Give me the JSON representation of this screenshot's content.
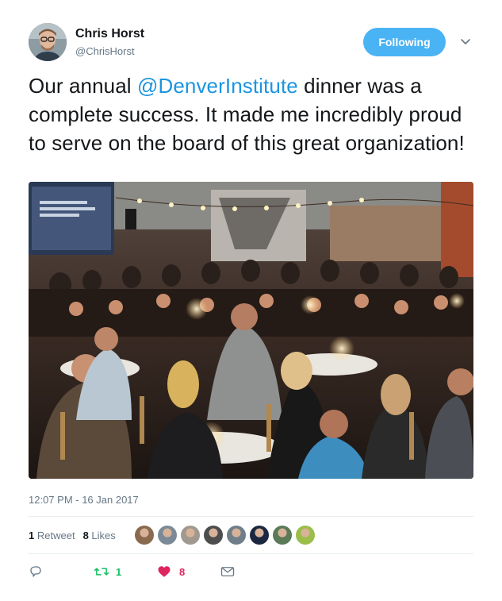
{
  "author": {
    "name": "Chris Horst",
    "handle": "@ChrisHorst",
    "avatar_icon": "person-avatar"
  },
  "follow_button": {
    "label": "Following",
    "color": "#4ab3f4"
  },
  "menu_icon": "chevron-down-icon",
  "tweet": {
    "text_before": "Our annual ",
    "mention": "@DenverInstitute",
    "text_after": " dinner was a complete success. It made me incredibly proud to serve on the board of this great organization!",
    "mention_color": "#1b95e0"
  },
  "photo": {
    "subject": "banquet-dinner-photo"
  },
  "timestamp": "12:07 PM - 16 Jan 2017",
  "stats": {
    "retweets_count": "1",
    "retweets_label": "Retweet",
    "likes_count": "8",
    "likes_label": "Likes",
    "liker_avatar_colors": [
      "#8a6a4f",
      "#7b8a96",
      "#a1998f",
      "#4d4d4d",
      "#6f7f8a",
      "#1b2840",
      "#5a7a58",
      "#9bbd4a"
    ]
  },
  "actions": {
    "reply_icon": "reply-icon",
    "retweet_icon": "retweet-icon",
    "retweet_count": "1",
    "retweet_color": "#17bf63",
    "like_icon": "heart-icon",
    "like_count": "8",
    "like_color": "#e0245e",
    "dm_icon": "envelope-icon"
  }
}
